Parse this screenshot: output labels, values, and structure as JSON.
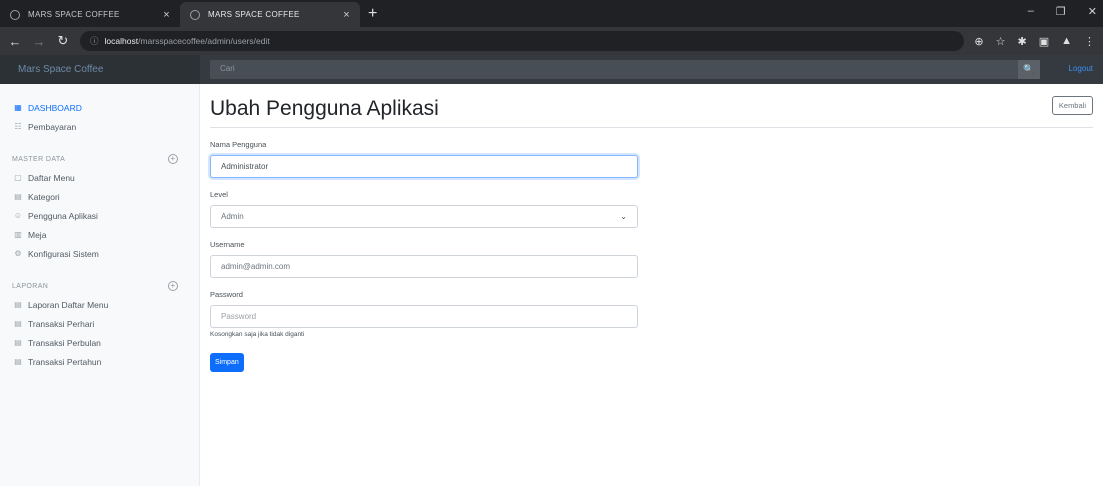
{
  "browser": {
    "tabs": [
      {
        "title": "MARS SPACE COFFEE",
        "close": "×"
      },
      {
        "title": "MARS SPACE COFFEE",
        "close": "×"
      }
    ],
    "new_tab": "+",
    "window_controls": {
      "minimize": "–",
      "restore": "❐",
      "close": "✕"
    },
    "url_host": "localhost",
    "url_path": "/marsspacecoffee/admin/users/edit"
  },
  "appbar": {
    "brand": "Mars Space Coffee",
    "search_placeholder": "Cari",
    "search_button": "🔍",
    "signout": "Logout"
  },
  "sidebar": {
    "top_items": [
      {
        "icon": "▦",
        "label": "DASHBOARD"
      },
      {
        "icon": "☷",
        "label": "Pembayaran"
      }
    ],
    "sections": [
      {
        "heading": "MASTER DATA",
        "toggle": "+",
        "items": [
          {
            "icon": "▢",
            "label": "Daftar Menu"
          },
          {
            "icon": "▤",
            "label": "Kategori"
          },
          {
            "icon": "☺",
            "label": "Pengguna Aplikasi"
          },
          {
            "icon": "▥",
            "label": "Meja"
          },
          {
            "icon": "⚙",
            "label": "Konfigurasi Sistem"
          }
        ]
      },
      {
        "heading": "LAPORAN",
        "toggle": "+",
        "items": [
          {
            "icon": "▤",
            "label": "Laporan Daftar Menu"
          },
          {
            "icon": "▤",
            "label": "Transaksi Perhari"
          },
          {
            "icon": "▤",
            "label": "Transaksi Perbulan"
          },
          {
            "icon": "▤",
            "label": "Transaksi Pertahun"
          }
        ]
      }
    ]
  },
  "main": {
    "title": "Ubah Pengguna Aplikasi",
    "back_button": "Kembali",
    "form": {
      "name_label": "Nama Pengguna",
      "name_value": "Administrator",
      "level_label": "Level",
      "level_value": "Admin",
      "username_label": "Username",
      "username_value": "admin@admin.com",
      "password_label": "Password",
      "password_placeholder": "Password",
      "password_help": "Kosongkan saja jika tidak diganti",
      "submit_label": "Simpan"
    }
  },
  "colors": {
    "primary": "#0d6efd",
    "navbar": "#343a40",
    "sidebar_bg": "#f8f9fa"
  }
}
